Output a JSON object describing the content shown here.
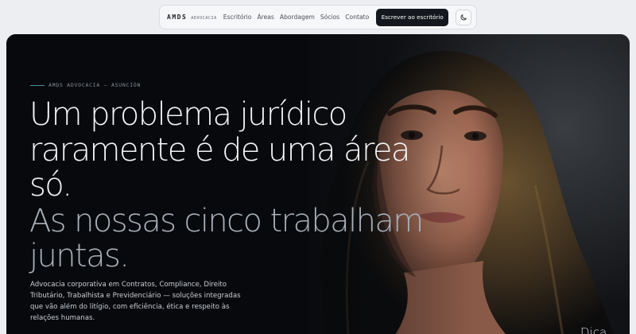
{
  "nav": {
    "brand": "AMDS",
    "brand_sub": "ADVOCACIA",
    "links": [
      "Escritório",
      "Áreas",
      "Abordagem",
      "Sócios",
      "Contato"
    ],
    "cta": "Escrever ao escritório",
    "theme_icon": "moon-icon"
  },
  "hero": {
    "eyebrow": "AMDS ADVOCACIA — ASUNCIÓN",
    "headline_primary": "Um problema jurídico raramente é de uma área só.",
    "headline_secondary": "As nossas cinco trabalham juntas.",
    "lead": "Advocacia corporativa em Contratos, Compliance, Direito Tributário, Trabalhista e Previdenciário — soluções integradas que vão além do litígio, com eficiência, ética e respeito às relações humanas.",
    "photo": "portrait-photo",
    "corner_text": "Dica"
  },
  "colors": {
    "page_bg": "#eceef2",
    "hero_bg": "#07090c",
    "cta_bg": "#14171d",
    "accent_line": "#4f8f9c",
    "headline": "#f3f4f6",
    "headline_secondary": "#a9b0ba"
  }
}
